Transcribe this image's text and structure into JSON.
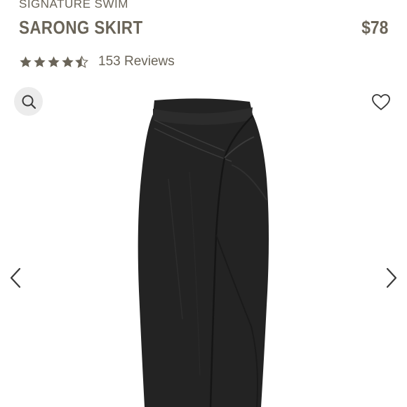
{
  "product": {
    "collection": "SIGNATURE SWIM",
    "name": "SARONG SKIRT",
    "price": "$78",
    "rating": 4.5,
    "reviews_label": "153 Reviews"
  },
  "colors": {
    "text": "#6a6458",
    "star": "#6a6458",
    "zoom_bg": "#ececec",
    "garment": "#222222"
  },
  "icons": {
    "zoom": "magnifier-icon",
    "wishlist": "heart-outline-icon",
    "previous": "chevron-left-icon",
    "next": "chevron-right-icon"
  }
}
